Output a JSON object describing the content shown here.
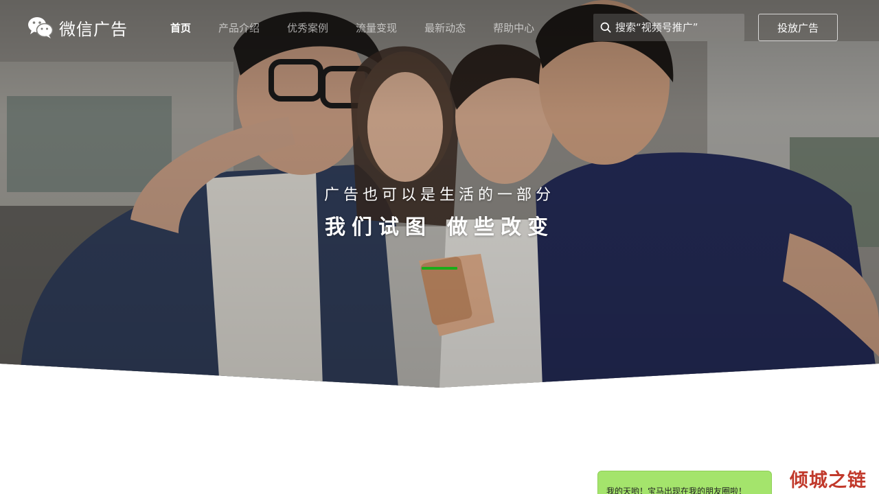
{
  "brand": {
    "name": "微信广告"
  },
  "nav": {
    "items": [
      {
        "label": "首页",
        "active": true
      },
      {
        "label": "产品介绍",
        "active": false
      },
      {
        "label": "优秀案例",
        "active": false
      },
      {
        "label": "流量变现",
        "active": false
      },
      {
        "label": "最新动态",
        "active": false
      },
      {
        "label": "帮助中心",
        "active": false
      }
    ],
    "search_placeholder": "搜索“视频号推广”",
    "cta_label": "投放广告"
  },
  "hero": {
    "subtitle": "广告也可以是生活的一部分",
    "title_part1": "我们试图",
    "title_part2": "做些改变",
    "indicator_color": "#1aad19"
  },
  "bubble": {
    "text": "我的天哟！宝马出现在我的朋友圈啦！"
  },
  "watermark": {
    "text": "倾城之链"
  },
  "colors": {
    "accent": "#1aad19",
    "bubble": "#a4e46c",
    "watermark": "#c1392b"
  }
}
